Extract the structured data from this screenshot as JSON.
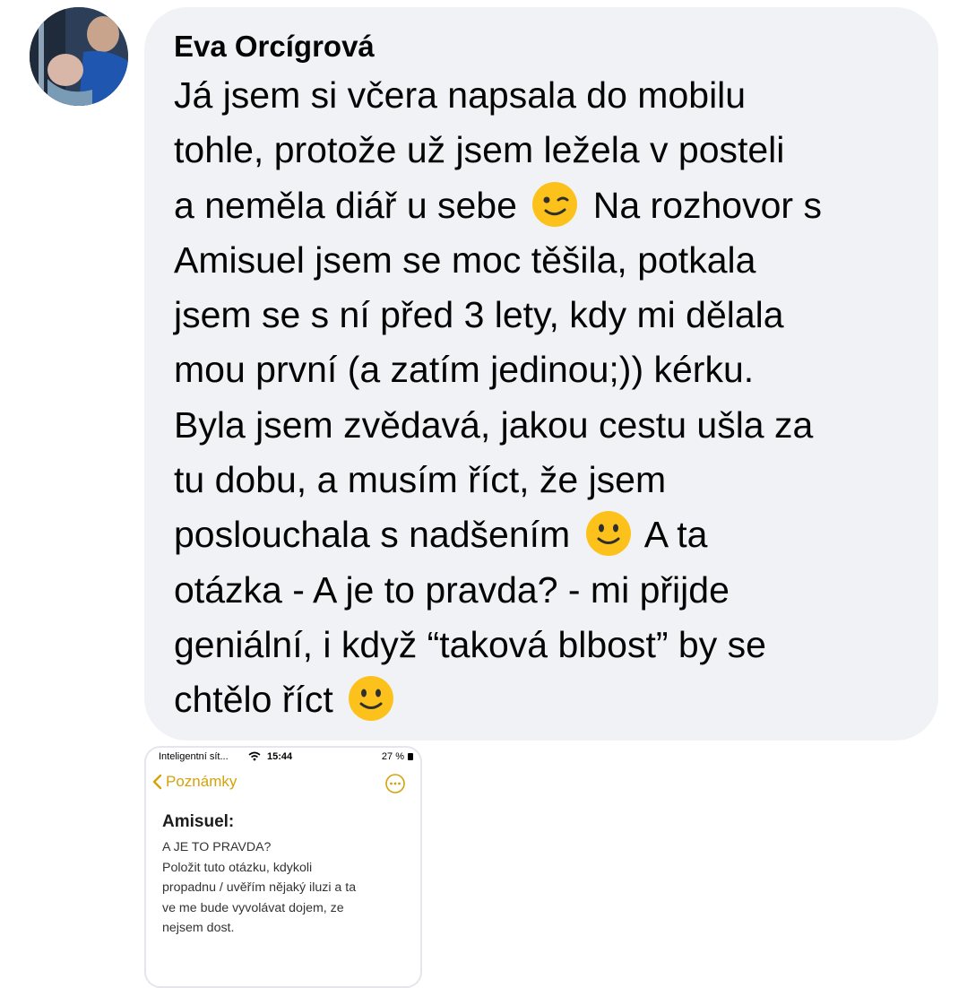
{
  "comment": {
    "author": "Eva Orcígrová",
    "segments": {
      "s1": "Já jsem si včera napsala do mobilu",
      "s2": "tohle, protože už jsem ležela v posteli",
      "s3a": "a neměla diář u sebe",
      "s3b": "Na rozhovor s",
      "s4": "Amisuel jsem se moc těšila, potkala",
      "s5": "jsem se s ní před 3 lety, kdy mi dělala",
      "s6": "mou první (a zatím jedinou;)) kérku.",
      "s7": "Byla jsem zvědavá, jakou cestu ušla za",
      "s8": "tu dobu, a musím říct, že jsem",
      "s9a": "poslouchala s nadšením",
      "s9b": "A ta",
      "s10": "otázka - A je to pravda? - mi přijde",
      "s11": "geniální, i když “taková blbost” by se",
      "s12": "chtělo říct"
    },
    "emojis": [
      "winking-face",
      "slightly-smiling-face",
      "slightly-smiling-face"
    ]
  },
  "attachment": {
    "status_bar": {
      "carrier": "Inteligentní sít...",
      "time": "15:44",
      "battery": "27 %"
    },
    "nav": {
      "back_label": "Poznámky"
    },
    "note": {
      "title": "Amisuel:",
      "lines": [
        "A JE TO PRAVDA?",
        "Položit tuto otázku, kdykoli",
        "propadnu / uvěřím nějaký iluzi a ta",
        "ve me bude vyvolávat dojem, ze",
        "nejsem dost."
      ]
    },
    "accent_color": "#d4a20a"
  }
}
